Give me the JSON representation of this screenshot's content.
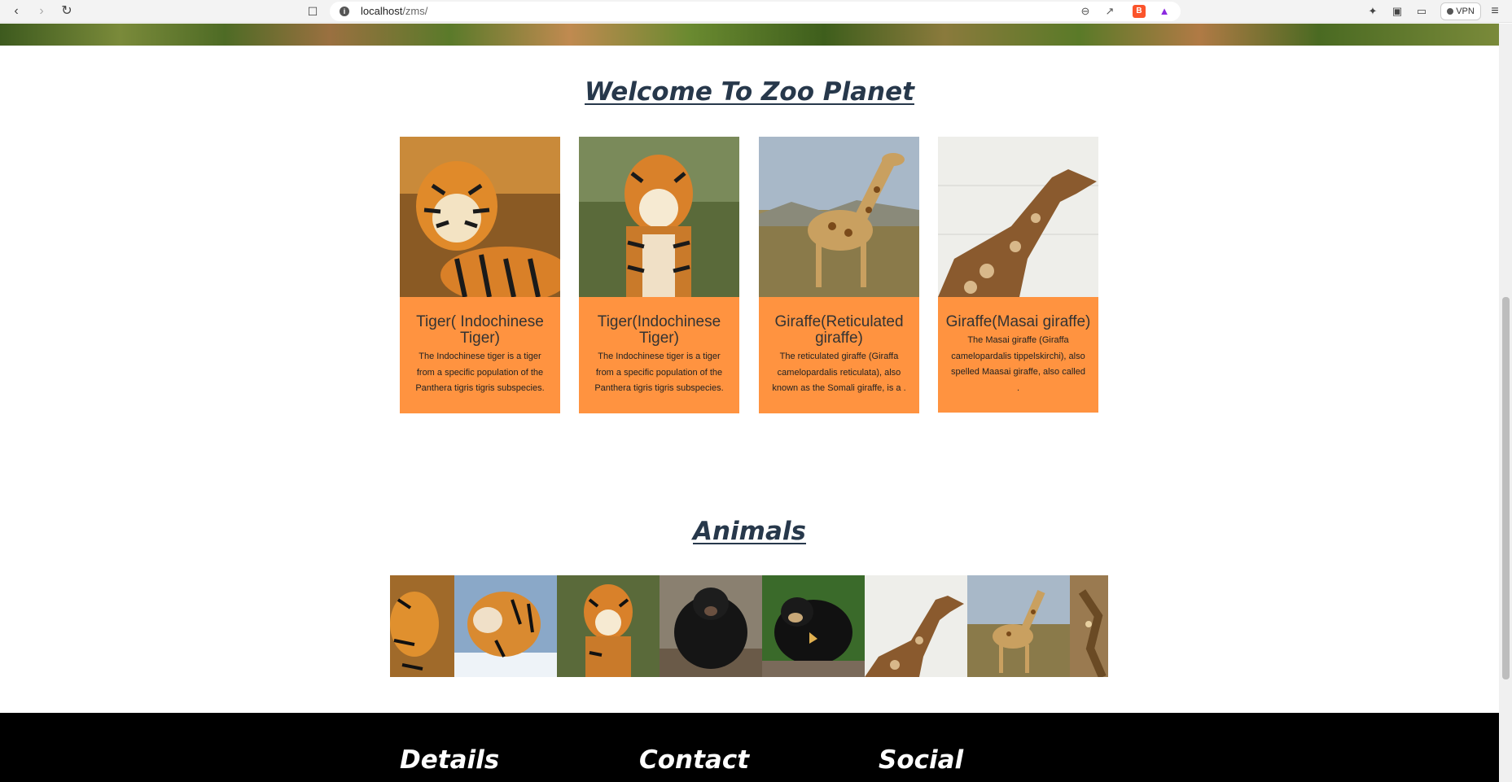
{
  "browser": {
    "url_host": "localhost",
    "url_path": "/zms/",
    "vpn_label": "VPN",
    "icons": [
      "back-icon",
      "forward-icon",
      "reload-icon",
      "bookmark-icon",
      "site-info-icon",
      "zoom-icon",
      "share-icon",
      "brave-shields-icon",
      "brave-rewards-icon",
      "extensions-icon",
      "sidebar-icon",
      "wallet-icon",
      "menu-icon"
    ]
  },
  "page": {
    "welcome_heading": "Welcome To Zoo Planet",
    "animals_heading": "Animals",
    "cards": [
      {
        "title": "Tiger( Indochinese Tiger)",
        "description": "The Indochinese tiger is a tiger from a specific population of the Panthera tigris tigris subspecies.",
        "image": "tiger-lying"
      },
      {
        "title": "Tiger(Indochinese Tiger)",
        "description": "The Indochinese tiger is a tiger from a specific population of the Panthera tigris tigris subspecies.",
        "image": "tiger-standing"
      },
      {
        "title": "Giraffe(Reticulated giraffe)",
        "description": "The reticulated giraffe (Giraffa camelopardalis reticulata), also known as the Somali giraffe, is a .",
        "image": "giraffe-savanna"
      },
      {
        "title": "Giraffe(Masai giraffe)",
        "description": "The Masai giraffe (Giraffa camelopardalis tippelskirchi), also spelled Maasai giraffe, also called .",
        "image": "giraffe-wall"
      }
    ],
    "gallery": [
      "tiger-lying",
      "tiger-snow",
      "tiger-standing",
      "black-bear",
      "sun-bear",
      "giraffe-wall",
      "giraffe-savanna",
      "giraffe-partial"
    ]
  },
  "footer": {
    "details": "Details",
    "contact": "Contact",
    "social": "Social"
  },
  "colors": {
    "card_orange": "#ff9340",
    "heading": "#27384b",
    "footer_bg": "#000000"
  }
}
